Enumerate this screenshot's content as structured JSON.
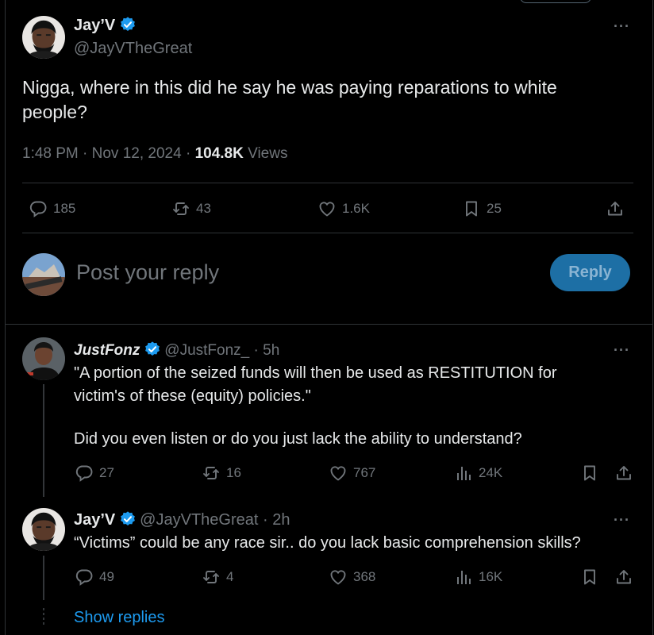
{
  "main_post": {
    "author_name": "Jay’V",
    "author_handle": "@JayVTheGreat",
    "text": "Nigga, where in this did he say he was paying reparations to white people?",
    "time": "1:48 PM · Nov 12, 2024 · ",
    "views_count": "104.8K",
    "views_label": " Views",
    "stats": {
      "replies": "185",
      "reposts": "43",
      "likes": "1.6K",
      "bookmarks": "25"
    }
  },
  "composer": {
    "placeholder": "Post your reply",
    "button_label": "Reply"
  },
  "replies": [
    {
      "author_name": "JustFonz",
      "author_handle": "@JustFonz_ · 5h",
      "line1": "\"A portion of the seized funds will then be used as RESTITUTION for",
      "line2": "victim's of these (equity) policies.\"",
      "line3": "Did you even listen or do you just lack the ability to understand?",
      "stats": {
        "replies": "27",
        "reposts": "16",
        "likes": "767",
        "views": "24K"
      }
    },
    {
      "author_name": "Jay’V",
      "author_handle": "@JayVTheGreat · 2h",
      "line1": "“Victims” could be any race sir.. do you lack basic comprehension skills?",
      "stats": {
        "replies": "49",
        "reposts": "4",
        "likes": "368",
        "views": "16K"
      }
    }
  ],
  "show_replies_label": "Show replies",
  "more_label": "···",
  "colors": {
    "background": "#000000",
    "text": "#e7e9ea",
    "secondary": "#71767b",
    "accent": "#1d9bf0",
    "divider": "#2f3336"
  }
}
